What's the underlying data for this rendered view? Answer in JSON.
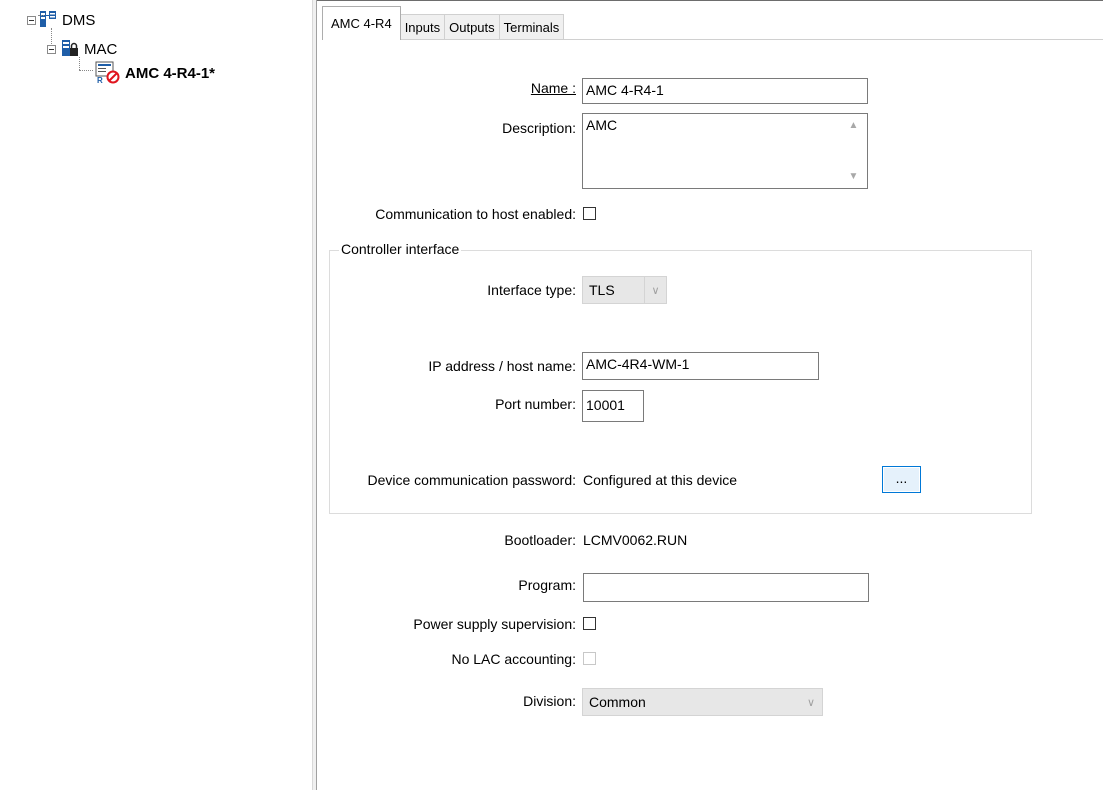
{
  "tree": {
    "root": {
      "label": "DMS"
    },
    "child": {
      "label": "MAC"
    },
    "leaf": {
      "label": "AMC 4-R4-1*"
    }
  },
  "tabs": [
    {
      "label": "AMC 4-R4",
      "active": true
    },
    {
      "label": "Inputs",
      "active": false
    },
    {
      "label": "Outputs",
      "active": false
    },
    {
      "label": "Terminals",
      "active": false
    }
  ],
  "form": {
    "name_label": "Name :",
    "name_value": "AMC 4-R4-1",
    "description_label": "Description:",
    "description_value": "AMC",
    "comm_label": "Communication to host enabled:",
    "comm_checked": false,
    "controller_group_title": "Controller interface",
    "interface_type_label": "Interface type:",
    "interface_type_value": "TLS",
    "ip_label": "IP address / host name:",
    "ip_value": "AMC-4R4-WM-1",
    "port_label": "Port number:",
    "port_value": "10001",
    "password_label": "Device communication password:",
    "password_value": "Configured at this device",
    "password_button": "...",
    "bootloader_label": "Bootloader:",
    "bootloader_value": "LCMV0062.RUN",
    "program_label": "Program:",
    "program_value": "",
    "power_label": "Power supply supervision:",
    "power_checked": false,
    "lac_label": "No LAC accounting:",
    "lac_checked": false,
    "division_label": "Division:",
    "division_value": "Common"
  },
  "colors": {
    "accent_button_border": "#0078d7",
    "tree_icon_blue": "#1f5ea8",
    "status_red": "#e0141e"
  }
}
